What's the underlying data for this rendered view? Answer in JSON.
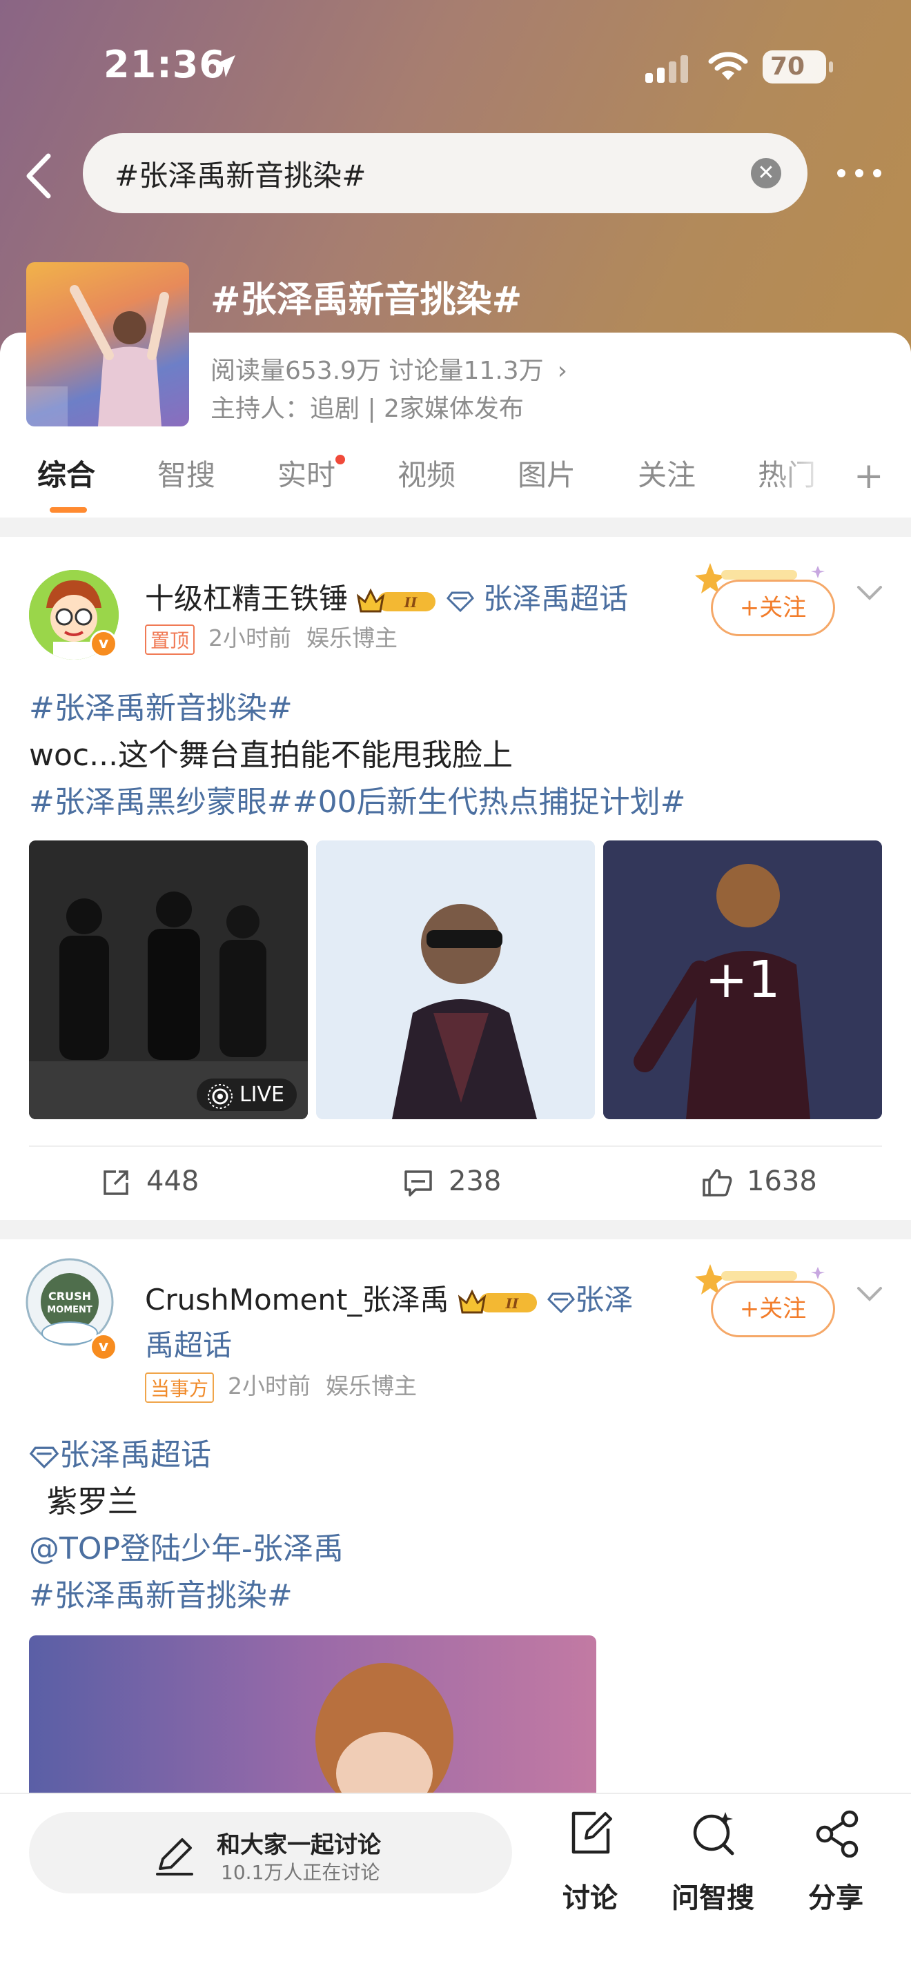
{
  "status_bar": {
    "time": "21:36",
    "battery": "70"
  },
  "search": {
    "query": "#张泽禹新音挑染#"
  },
  "topic": {
    "title": "#张泽禹新音挑染#",
    "stats": "阅读量653.9万  讨论量11.3万",
    "host": "主持人：追剧 | 2家媒体发布"
  },
  "tabs": [
    {
      "label": "综合"
    },
    {
      "label": "智搜"
    },
    {
      "label": "实时"
    },
    {
      "label": "视频"
    },
    {
      "label": "图片"
    },
    {
      "label": "关注"
    },
    {
      "label": "热门"
    }
  ],
  "post1": {
    "username": "十级杠精王铁锤",
    "super_topic": "张泽禹超话",
    "pin_tag": "置顶",
    "time": "2小时前",
    "role": "娱乐博主",
    "follow_label": "+关注",
    "line1": "#张泽禹新音挑染#",
    "line2": "woc...这个舞台直拍能不能甩我脸上",
    "line3": "#张泽禹黑纱蒙眼##00后新生代热点捕捉计划#",
    "live_label": "LIVE",
    "more_images": "+1",
    "reposts": "448",
    "comments": "238",
    "likes": "1638"
  },
  "post2": {
    "username": "CrushMoment_张泽禹",
    "super_topic_a": "张泽",
    "super_topic_b": "禹超话",
    "party_tag": "当事方",
    "time": "2小时前",
    "role": "娱乐博主",
    "follow_label": "+关注",
    "line1": "张泽禹超话",
    "line2": "紫罗兰",
    "line3": "@TOP登陆少年-张泽禹",
    "line4": "#张泽禹新音挑染#"
  },
  "bottom_bar": {
    "compose_title": "和大家一起讨论",
    "compose_sub": "10.1万人正在讨论",
    "discuss": "讨论",
    "ask": "问智搜",
    "share": "分享"
  },
  "colors": {
    "accent": "#ff8a30",
    "link": "#4b6fa0",
    "follow": "#f27d2b"
  }
}
